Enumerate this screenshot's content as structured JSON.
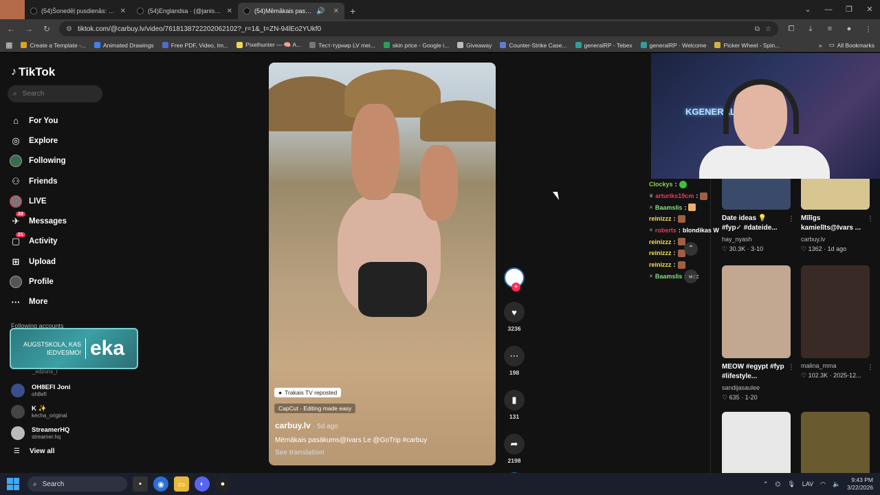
{
  "browser": {
    "tabs": [
      {
        "title": "(54)Šonedēļ pusdienās: 🥘 Juh",
        "active": false
      },
      {
        "title": "(54)Englandsa · (@janistiltsen",
        "active": false
      },
      {
        "title": "(54)Mēmākais pasākums@",
        "active": true
      }
    ],
    "url": "tiktok.com/@carbuy.lv/video/7618138722202062102?_r=1&_t=ZN-94lEo2YUkf0",
    "bookmarks": [
      "Create a Template -...",
      "Animated Drawings",
      "Free PDF, Video, Im...",
      "Pixelhunter — 🧠 A...",
      "Тест-турнир LV mei...",
      "skin price - Google i...",
      "Giveaway",
      "Counter-Strike Case...",
      "generalRP - Tebex",
      "generalRP · Welcome",
      "Picker Wheel - Spin..."
    ],
    "all_bookmarks": "All Bookmarks"
  },
  "sidebar": {
    "logo": "TikTok",
    "search_placeholder": "Search",
    "nav": [
      {
        "label": "For You",
        "icon": "home-icon",
        "badge": ""
      },
      {
        "label": "Explore",
        "icon": "compass-icon",
        "badge": ""
      },
      {
        "label": "Following",
        "icon": "following-avatar",
        "badge": ""
      },
      {
        "label": "Friends",
        "icon": "friends-icon",
        "badge": ""
      },
      {
        "label": "LIVE",
        "icon": "live-avatar",
        "badge": ""
      },
      {
        "label": "Messages",
        "icon": "messages-icon",
        "badge": "33"
      },
      {
        "label": "Activity",
        "icon": "activity-icon",
        "badge": "21"
      },
      {
        "label": "Upload",
        "icon": "upload-icon",
        "badge": ""
      },
      {
        "label": "Profile",
        "icon": "profile-avatar",
        "badge": ""
      },
      {
        "label": "More",
        "icon": "more-icon",
        "badge": ""
      }
    ],
    "following_header": "Following accounts",
    "overlay_banner": {
      "left_text_line1": "AUGSTSKOLA, KAS",
      "left_text_line2": "IEDVESMO!",
      "right_text": "eka"
    },
    "hidden_handle": "_edzons_r",
    "accounts": [
      {
        "name": "OH8EFI Joni",
        "handle": "oh8efi"
      },
      {
        "name": "K ✨",
        "handle": "kecha_original"
      },
      {
        "name": "StreamerHQ",
        "handle": "streamer.hq"
      }
    ],
    "view_all": "View all"
  },
  "video": {
    "repost_label": "Trakais TV reposted",
    "capcut_label": "CapCut · Editing made easy",
    "author": "carbuy.lv",
    "date": "· 5d ago",
    "description": "Mēmākais pasākums@Ivars Le @GoTrip #carbuy",
    "see_translation": "See translation",
    "likes": "3236",
    "comments": "198",
    "saves": "131",
    "shares": "2198"
  },
  "chat": [
    {
      "user": "Clockys",
      "msg": "",
      "color": "#8fd14f"
    },
    {
      "user": "arturiks19cm",
      "msg": "",
      "color": "#e0405a"
    },
    {
      "user": "Baamslis",
      "msg": "",
      "color": "#7ee07e"
    },
    {
      "user": "reinizzz",
      "msg": "",
      "color": "#f0e050"
    },
    {
      "user": "roberts",
      "msg": "blondikas W",
      "color": "#e0405a"
    },
    {
      "user": "reinizzz",
      "msg": "",
      "color": "#f0e050"
    },
    {
      "user": "reinizzz",
      "msg": "",
      "color": "#f0e050"
    },
    {
      "user": "reinizzz",
      "msg": "",
      "color": "#f0e050"
    },
    {
      "user": "Baamslis",
      "msg": "rizz",
      "color": "#7ee07e"
    }
  ],
  "recs": [
    {
      "title": "Date ideas 💡 #fyp✓ #dateide...",
      "user": "hay_nyash",
      "stats": "♡ 30.3K · 3-10"
    },
    {
      "title": "Mīlīgs kamielīts@Ivars ...",
      "user": "carbuy.lv",
      "stats": "♡ 1362 · 1d ago"
    },
    {
      "title": "MEOW #egypt #fyp #lifestyle...",
      "user": "sandijasaulee",
      "stats": "♡ 635 · 1-20"
    },
    {
      "title": "",
      "user": "malina_mma",
      "stats": "♡ 102.3K · 2025-12..."
    }
  ],
  "webcam": {
    "sign_text": "KGENERALE"
  },
  "taskbar": {
    "search_placeholder": "Search",
    "lang": "LAV",
    "time": "9:43 PM",
    "date": "3/22/2026"
  }
}
